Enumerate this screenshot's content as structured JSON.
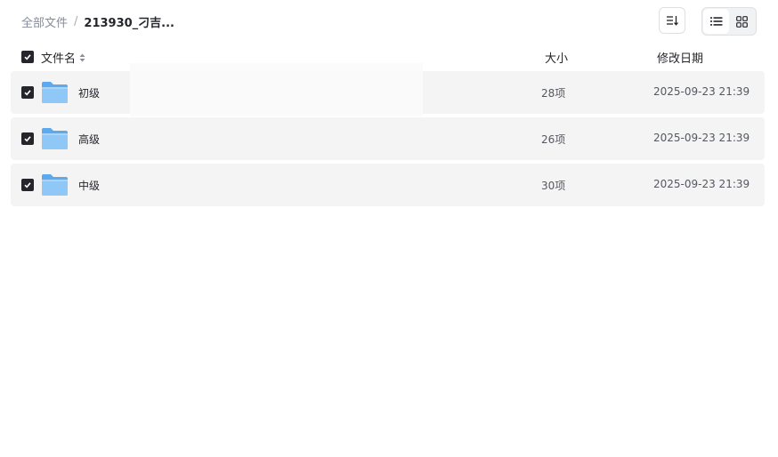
{
  "breadcrumb": {
    "root": "全部文件",
    "separator": "/",
    "current": "213930_刁吉..."
  },
  "toolbar": {
    "sort_icon": "sort-icon",
    "view_list_icon": "list-view-icon",
    "view_grid_icon": "grid-view-icon",
    "active_view": "list"
  },
  "table": {
    "headers": {
      "name": "文件名",
      "size": "大小",
      "date": "修改日期"
    },
    "rows": [
      {
        "name": "初级",
        "size": "28项",
        "date": "2025-09-23 21:39",
        "checked": true,
        "icon": "folder-icon"
      },
      {
        "name": "高级",
        "size": "26项",
        "date": "2025-09-23 21:39",
        "checked": true,
        "icon": "folder-icon"
      },
      {
        "name": "中级",
        "size": "30项",
        "date": "2025-09-23 21:39",
        "checked": true,
        "icon": "folder-icon"
      }
    ]
  },
  "colors": {
    "folder": "#6fb3f0",
    "row_bg": "#f4f4f5",
    "checkbox": "#25262b"
  }
}
